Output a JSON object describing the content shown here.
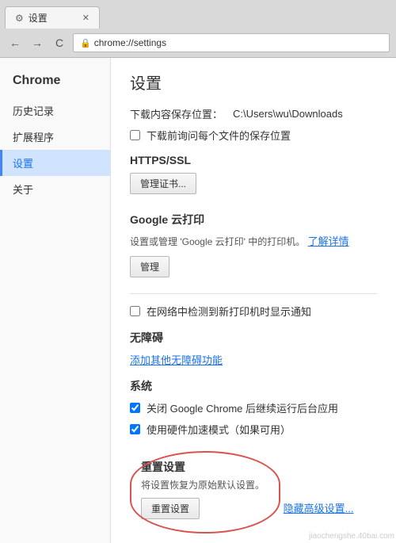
{
  "browser": {
    "tab_title": "设置",
    "address": "chrome://settings",
    "nav_back": "←",
    "nav_forward": "→",
    "nav_refresh": "C"
  },
  "sidebar": {
    "brand": "Chrome",
    "items": [
      {
        "id": "history",
        "label": "历史记录"
      },
      {
        "id": "extensions",
        "label": "扩展程序"
      },
      {
        "id": "settings",
        "label": "设置",
        "active": true
      },
      {
        "id": "about",
        "label": "关于"
      }
    ]
  },
  "main": {
    "page_title": "设置",
    "download_label": "下载内容保存位置：",
    "download_path": "C:\\Users\\wu\\Downloads",
    "ask_each_time": "下载前询问每个文件的保存位置",
    "https_section": "HTTPS/SSL",
    "manage_cert_btn": "管理证书...",
    "google_cloud_title": "Google 云打印",
    "google_cloud_desc": "设置或管理 'Google 云打印' 中的打印机。了解详情",
    "google_cloud_desc_plain": "设置或管理 'Google 云打印' 中的打印机。",
    "google_cloud_learn": "了解详情",
    "manage_btn": "管理",
    "notify_printer": "在网络中检测到新打印机时显示通知",
    "accessibility_title": "无障碍",
    "add_accessibility": "添加其他无障碍功能",
    "system_title": "系统",
    "bg_run_label": "关闭 Google Chrome 后继续运行后台应用",
    "hardware_accel_label": "使用硬件加速模式（如果可用）",
    "reset_title": "重置设置",
    "reset_desc": "将设置恢复为原始默认设置。",
    "reset_btn": "重置设置",
    "hide_advanced": "隐藏高级设置..."
  },
  "watermark": "jiaochengshe.40bai.com"
}
